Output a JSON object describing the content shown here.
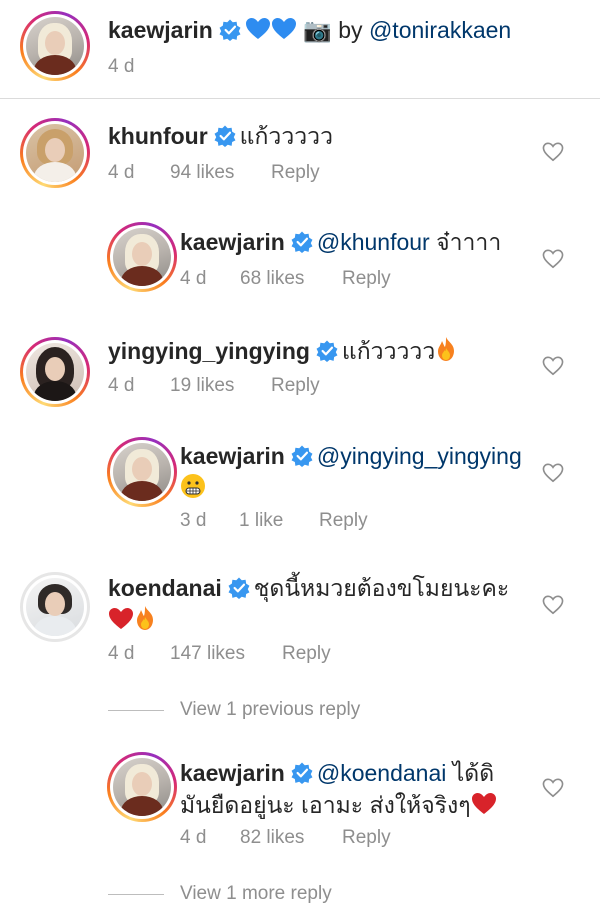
{
  "caption": {
    "username": "kaewjarin",
    "text_after": " 📷 by ",
    "mention": "@tonirakkaen",
    "time": "4 d"
  },
  "comments": [
    {
      "username": "khunfour",
      "text": "แก้ววววว",
      "time": "4 d",
      "likes": "94 likes",
      "reply": "Reply"
    },
    {
      "username": "kaewjarin",
      "mention": "@khunfour",
      "text": " จ๋าาาา",
      "time": "4 d",
      "likes": "68 likes",
      "reply": "Reply"
    },
    {
      "username": "yingying_yingying",
      "text": "แก้ววววว",
      "time": "4 d",
      "likes": "19 likes",
      "reply": "Reply"
    },
    {
      "username": "kaewjarin",
      "mention": "@yingying_yingying",
      "text": "",
      "time": "3 d",
      "likes": "1 like",
      "reply": "Reply"
    },
    {
      "username": "koendanai",
      "text": "ชุดนี้หมวยต้องขโมยนะคะ",
      "time": "4 d",
      "likes": "147 likes",
      "reply": "Reply"
    },
    {
      "username": "kaewjarin",
      "mention": "@koendanai",
      "text": " ได้ดิ",
      "text_line2": "มันยืดอยู่นะ เอามะ ส่งให้จริงๆ",
      "time": "4 d",
      "likes": "82 likes",
      "reply": "Reply"
    }
  ],
  "view_replies": [
    {
      "label": "View 1 previous reply"
    },
    {
      "label": "View 1 more reply"
    }
  ],
  "colors": {
    "verified": "#3897f0",
    "mention": "#00376b",
    "meta": "#8e8e8e",
    "heart_emoji": "#d8232a",
    "blue_heart": "#2e8cf0"
  }
}
